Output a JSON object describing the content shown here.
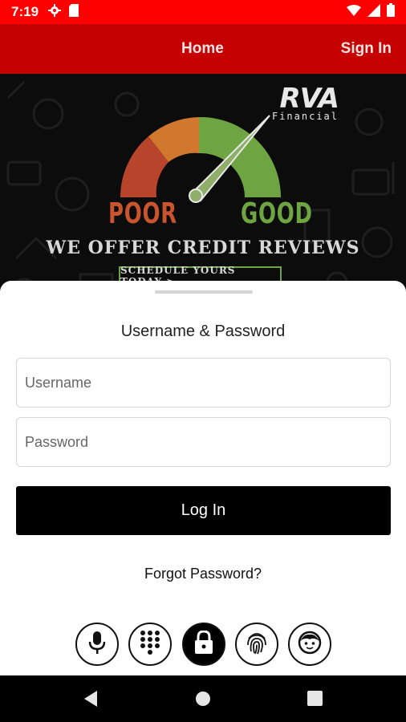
{
  "status_bar": {
    "time": "7:19",
    "left_icons": [
      "gear-icon",
      "sd-card-icon"
    ],
    "right_icons": [
      "wifi-icon",
      "signal-icon",
      "battery-icon"
    ],
    "color": "#ff0000"
  },
  "app_bar": {
    "home_label": "Home",
    "signin_label": "Sign In",
    "color": "#c40000"
  },
  "banner": {
    "logo_main": "RVA",
    "logo_sub": "Financial",
    "poor_label": "POOR",
    "good_label": "GOOD",
    "headline": "WE OFFER CREDIT REVIEWS",
    "cta": "SCHEDULE YOURS TODAY >",
    "gauge_colors": [
      "#b8442b",
      "#d0782e",
      "#6ea542"
    ]
  },
  "login": {
    "title": "Username & Password",
    "username_placeholder": "Username",
    "username_value": "",
    "password_placeholder": "Password",
    "password_value": "",
    "login_label": "Log In",
    "forgot_label": "Forgot Password?"
  },
  "auth_methods": [
    {
      "icon": "microphone-icon",
      "active": false
    },
    {
      "icon": "keypad-icon",
      "active": false
    },
    {
      "icon": "lock-icon",
      "active": true
    },
    {
      "icon": "fingerprint-icon",
      "active": false
    },
    {
      "icon": "face-icon",
      "active": false
    }
  ],
  "nav_bar": {
    "buttons": [
      "back-icon",
      "home-icon",
      "recents-icon"
    ]
  }
}
